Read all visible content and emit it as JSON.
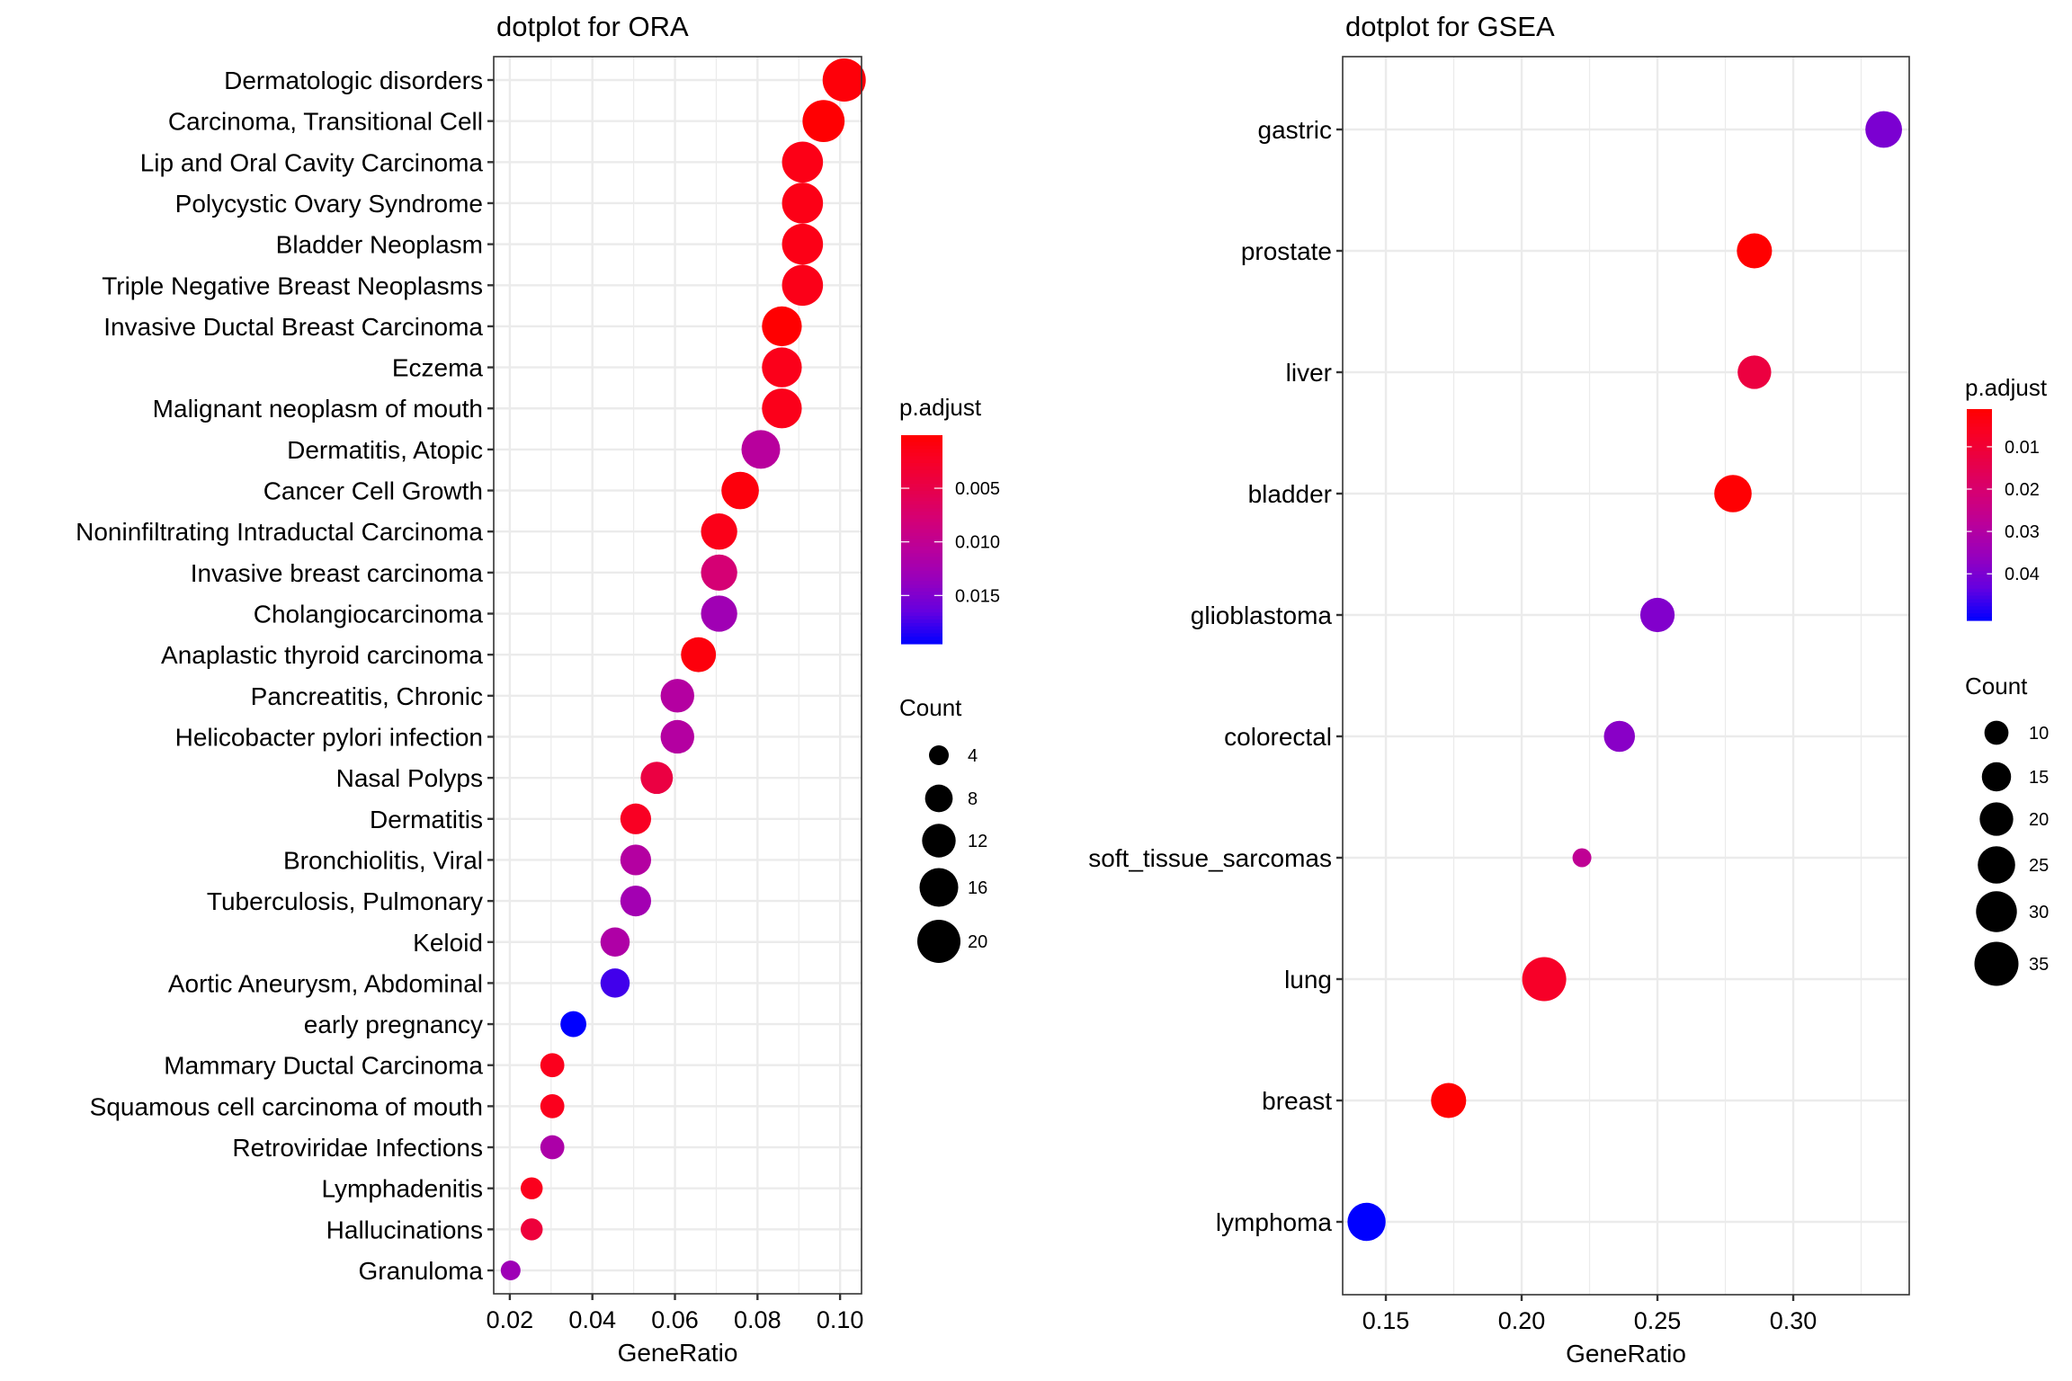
{
  "chart_data": [
    {
      "type": "scatter",
      "title": "dotplot for ORA",
      "xlabel": "GeneRatio",
      "ylabel": "",
      "xlim": [
        0.0161,
        0.1052
      ],
      "xticks": [
        0.02,
        0.04,
        0.06,
        0.08,
        0.1
      ],
      "xtick_labels": [
        "0.02",
        "0.04",
        "0.06",
        "0.08",
        "0.10"
      ],
      "xminor": [
        0.03,
        0.05,
        0.07,
        0.09
      ],
      "grid": true,
      "color_legend": {
        "title": "p.adjust",
        "range": [
          5e-05,
          0.0195
        ],
        "low_color": "#FF0000",
        "high_color": "#0000FF",
        "ticks": [
          0.005,
          0.01,
          0.015
        ],
        "tick_labels": [
          "0.005",
          "0.010",
          "0.015"
        ]
      },
      "size_legend": {
        "title": "Count",
        "values": [
          4,
          8,
          12,
          16,
          20
        ],
        "labels": [
          "4",
          "8",
          "12",
          "16",
          "20"
        ],
        "range": [
          4,
          20
        ]
      },
      "legend_position": "right",
      "categories": [
        "Dermatologic disorders",
        "Carcinoma, Transitional Cell",
        "Lip and Oral Cavity Carcinoma",
        "Polycystic Ovary Syndrome",
        "Bladder Neoplasm",
        "Triple Negative Breast Neoplasms",
        "Invasive Ductal Breast Carcinoma",
        "Eczema",
        "Malignant neoplasm of mouth",
        "Dermatitis, Atopic",
        "Cancer Cell Growth",
        "Noninfiltrating Intraductal Carcinoma",
        "Invasive breast carcinoma",
        "Cholangiocarcinoma",
        "Anaplastic thyroid carcinoma",
        "Pancreatitis, Chronic",
        "Helicobacter pylori infection",
        "Nasal Polyps",
        "Dermatitis",
        "Bronchiolitis, Viral",
        "Tuberculosis, Pulmonary",
        "Keloid",
        "Aortic Aneurysm, Abdominal",
        "early pregnancy",
        "Mammary Ductal Carcinoma",
        "Squamous cell carcinoma of mouth",
        "Retroviridae Infections",
        "Lymphadenitis",
        "Hallucinations",
        "Granuloma"
      ],
      "gene_ratio": [
        0.101,
        0.096,
        0.0909,
        0.0909,
        0.0909,
        0.0909,
        0.0859,
        0.0859,
        0.0859,
        0.0808,
        0.0758,
        0.0707,
        0.0707,
        0.0707,
        0.0657,
        0.0606,
        0.0606,
        0.0556,
        0.0505,
        0.0505,
        0.0505,
        0.0455,
        0.0455,
        0.0354,
        0.0303,
        0.0303,
        0.0303,
        0.0253,
        0.0253,
        0.0202
      ],
      "count": [
        20,
        19,
        18,
        18,
        18,
        18,
        17,
        17,
        17,
        16,
        15,
        14,
        14,
        14,
        13,
        12,
        12,
        11,
        10,
        10,
        10,
        9,
        9,
        7,
        6,
        6,
        6,
        5,
        5,
        4
      ],
      "p_adjust": [
        0.0006,
        0.0002,
        0.0014,
        0.0014,
        0.0014,
        0.0015,
        0.0001,
        0.0016,
        0.0016,
        0.0108,
        0.0008,
        0.0015,
        0.0078,
        0.0128,
        0.0008,
        0.0112,
        0.0112,
        0.0045,
        0.0022,
        0.0112,
        0.0126,
        0.0116,
        0.0176,
        0.0195,
        0.0018,
        0.0018,
        0.0118,
        0.0018,
        0.004,
        0.013
      ]
    },
    {
      "type": "scatter",
      "title": "dotplot for GSEA",
      "xlabel": "GeneRatio",
      "ylabel": "",
      "xlim": [
        0.1341,
        0.3427
      ],
      "xticks": [
        0.15,
        0.2,
        0.25,
        0.3
      ],
      "xtick_labels": [
        "0.15",
        "0.20",
        "0.25",
        "0.30"
      ],
      "xminor": [
        0.175,
        0.225,
        0.275,
        0.325
      ],
      "grid": true,
      "color_legend": {
        "title": "p.adjust",
        "range": [
          0.0011,
          0.051
        ],
        "low_color": "#FF0000",
        "high_color": "#0000FF",
        "ticks": [
          0.01,
          0.02,
          0.03,
          0.04
        ],
        "tick_labels": [
          "0.01",
          "0.02",
          "0.03",
          "0.04"
        ]
      },
      "size_legend": {
        "title": "Count",
        "values": [
          10,
          15,
          20,
          25,
          30,
          35
        ],
        "labels": [
          "10",
          "15",
          "20",
          "25",
          "30",
          "35"
        ],
        "range": [
          6,
          35
        ]
      },
      "legend_position": "right",
      "categories": [
        "gastric",
        "prostate",
        "liver",
        "bladder",
        "glioblastoma",
        "colorectal",
        "soft_tissue_sarcomas",
        "lung",
        "breast",
        "lymphoma"
      ],
      "gene_ratio": [
        0.3333,
        0.2857,
        0.2857,
        0.2778,
        0.25,
        0.236,
        0.2222,
        0.2083,
        0.1731,
        0.1429
      ],
      "count": [
        24,
        22,
        20,
        25,
        21,
        17,
        6,
        35,
        22,
        26
      ],
      "p_adjust": [
        0.04,
        0.0012,
        0.012,
        0.0015,
        0.039,
        0.038,
        0.027,
        0.0075,
        0.0012,
        0.051
      ]
    }
  ]
}
